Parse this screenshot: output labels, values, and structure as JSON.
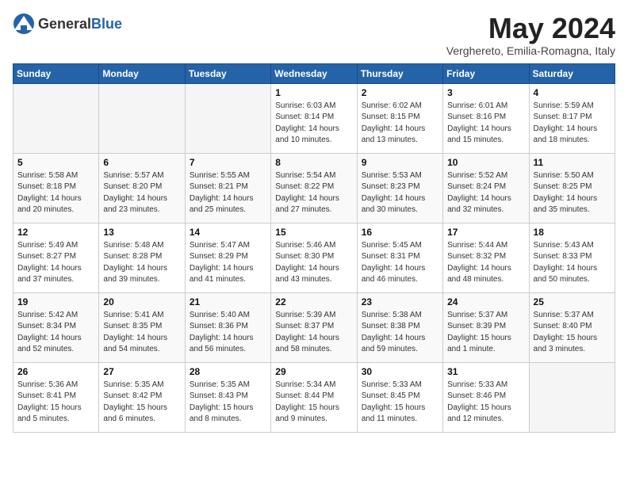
{
  "header": {
    "logo_general": "General",
    "logo_blue": "Blue",
    "month_year": "May 2024",
    "location": "Verghereto, Emilia-Romagna, Italy"
  },
  "days_of_week": [
    "Sunday",
    "Monday",
    "Tuesday",
    "Wednesday",
    "Thursday",
    "Friday",
    "Saturday"
  ],
  "weeks": [
    [
      {
        "day": "",
        "sunrise": "",
        "sunset": "",
        "daylight": ""
      },
      {
        "day": "",
        "sunrise": "",
        "sunset": "",
        "daylight": ""
      },
      {
        "day": "",
        "sunrise": "",
        "sunset": "",
        "daylight": ""
      },
      {
        "day": "1",
        "sunrise": "Sunrise: 6:03 AM",
        "sunset": "Sunset: 8:14 PM",
        "daylight": "Daylight: 14 hours and 10 minutes."
      },
      {
        "day": "2",
        "sunrise": "Sunrise: 6:02 AM",
        "sunset": "Sunset: 8:15 PM",
        "daylight": "Daylight: 14 hours and 13 minutes."
      },
      {
        "day": "3",
        "sunrise": "Sunrise: 6:01 AM",
        "sunset": "Sunset: 8:16 PM",
        "daylight": "Daylight: 14 hours and 15 minutes."
      },
      {
        "day": "4",
        "sunrise": "Sunrise: 5:59 AM",
        "sunset": "Sunset: 8:17 PM",
        "daylight": "Daylight: 14 hours and 18 minutes."
      }
    ],
    [
      {
        "day": "5",
        "sunrise": "Sunrise: 5:58 AM",
        "sunset": "Sunset: 8:18 PM",
        "daylight": "Daylight: 14 hours and 20 minutes."
      },
      {
        "day": "6",
        "sunrise": "Sunrise: 5:57 AM",
        "sunset": "Sunset: 8:20 PM",
        "daylight": "Daylight: 14 hours and 23 minutes."
      },
      {
        "day": "7",
        "sunrise": "Sunrise: 5:55 AM",
        "sunset": "Sunset: 8:21 PM",
        "daylight": "Daylight: 14 hours and 25 minutes."
      },
      {
        "day": "8",
        "sunrise": "Sunrise: 5:54 AM",
        "sunset": "Sunset: 8:22 PM",
        "daylight": "Daylight: 14 hours and 27 minutes."
      },
      {
        "day": "9",
        "sunrise": "Sunrise: 5:53 AM",
        "sunset": "Sunset: 8:23 PM",
        "daylight": "Daylight: 14 hours and 30 minutes."
      },
      {
        "day": "10",
        "sunrise": "Sunrise: 5:52 AM",
        "sunset": "Sunset: 8:24 PM",
        "daylight": "Daylight: 14 hours and 32 minutes."
      },
      {
        "day": "11",
        "sunrise": "Sunrise: 5:50 AM",
        "sunset": "Sunset: 8:25 PM",
        "daylight": "Daylight: 14 hours and 35 minutes."
      }
    ],
    [
      {
        "day": "12",
        "sunrise": "Sunrise: 5:49 AM",
        "sunset": "Sunset: 8:27 PM",
        "daylight": "Daylight: 14 hours and 37 minutes."
      },
      {
        "day": "13",
        "sunrise": "Sunrise: 5:48 AM",
        "sunset": "Sunset: 8:28 PM",
        "daylight": "Daylight: 14 hours and 39 minutes."
      },
      {
        "day": "14",
        "sunrise": "Sunrise: 5:47 AM",
        "sunset": "Sunset: 8:29 PM",
        "daylight": "Daylight: 14 hours and 41 minutes."
      },
      {
        "day": "15",
        "sunrise": "Sunrise: 5:46 AM",
        "sunset": "Sunset: 8:30 PM",
        "daylight": "Daylight: 14 hours and 43 minutes."
      },
      {
        "day": "16",
        "sunrise": "Sunrise: 5:45 AM",
        "sunset": "Sunset: 8:31 PM",
        "daylight": "Daylight: 14 hours and 46 minutes."
      },
      {
        "day": "17",
        "sunrise": "Sunrise: 5:44 AM",
        "sunset": "Sunset: 8:32 PM",
        "daylight": "Daylight: 14 hours and 48 minutes."
      },
      {
        "day": "18",
        "sunrise": "Sunrise: 5:43 AM",
        "sunset": "Sunset: 8:33 PM",
        "daylight": "Daylight: 14 hours and 50 minutes."
      }
    ],
    [
      {
        "day": "19",
        "sunrise": "Sunrise: 5:42 AM",
        "sunset": "Sunset: 8:34 PM",
        "daylight": "Daylight: 14 hours and 52 minutes."
      },
      {
        "day": "20",
        "sunrise": "Sunrise: 5:41 AM",
        "sunset": "Sunset: 8:35 PM",
        "daylight": "Daylight: 14 hours and 54 minutes."
      },
      {
        "day": "21",
        "sunrise": "Sunrise: 5:40 AM",
        "sunset": "Sunset: 8:36 PM",
        "daylight": "Daylight: 14 hours and 56 minutes."
      },
      {
        "day": "22",
        "sunrise": "Sunrise: 5:39 AM",
        "sunset": "Sunset: 8:37 PM",
        "daylight": "Daylight: 14 hours and 58 minutes."
      },
      {
        "day": "23",
        "sunrise": "Sunrise: 5:38 AM",
        "sunset": "Sunset: 8:38 PM",
        "daylight": "Daylight: 14 hours and 59 minutes."
      },
      {
        "day": "24",
        "sunrise": "Sunrise: 5:37 AM",
        "sunset": "Sunset: 8:39 PM",
        "daylight": "Daylight: 15 hours and 1 minute."
      },
      {
        "day": "25",
        "sunrise": "Sunrise: 5:37 AM",
        "sunset": "Sunset: 8:40 PM",
        "daylight": "Daylight: 15 hours and 3 minutes."
      }
    ],
    [
      {
        "day": "26",
        "sunrise": "Sunrise: 5:36 AM",
        "sunset": "Sunset: 8:41 PM",
        "daylight": "Daylight: 15 hours and 5 minutes."
      },
      {
        "day": "27",
        "sunrise": "Sunrise: 5:35 AM",
        "sunset": "Sunset: 8:42 PM",
        "daylight": "Daylight: 15 hours and 6 minutes."
      },
      {
        "day": "28",
        "sunrise": "Sunrise: 5:35 AM",
        "sunset": "Sunset: 8:43 PM",
        "daylight": "Daylight: 15 hours and 8 minutes."
      },
      {
        "day": "29",
        "sunrise": "Sunrise: 5:34 AM",
        "sunset": "Sunset: 8:44 PM",
        "daylight": "Daylight: 15 hours and 9 minutes."
      },
      {
        "day": "30",
        "sunrise": "Sunrise: 5:33 AM",
        "sunset": "Sunset: 8:45 PM",
        "daylight": "Daylight: 15 hours and 11 minutes."
      },
      {
        "day": "31",
        "sunrise": "Sunrise: 5:33 AM",
        "sunset": "Sunset: 8:46 PM",
        "daylight": "Daylight: 15 hours and 12 minutes."
      },
      {
        "day": "",
        "sunrise": "",
        "sunset": "",
        "daylight": ""
      }
    ]
  ]
}
